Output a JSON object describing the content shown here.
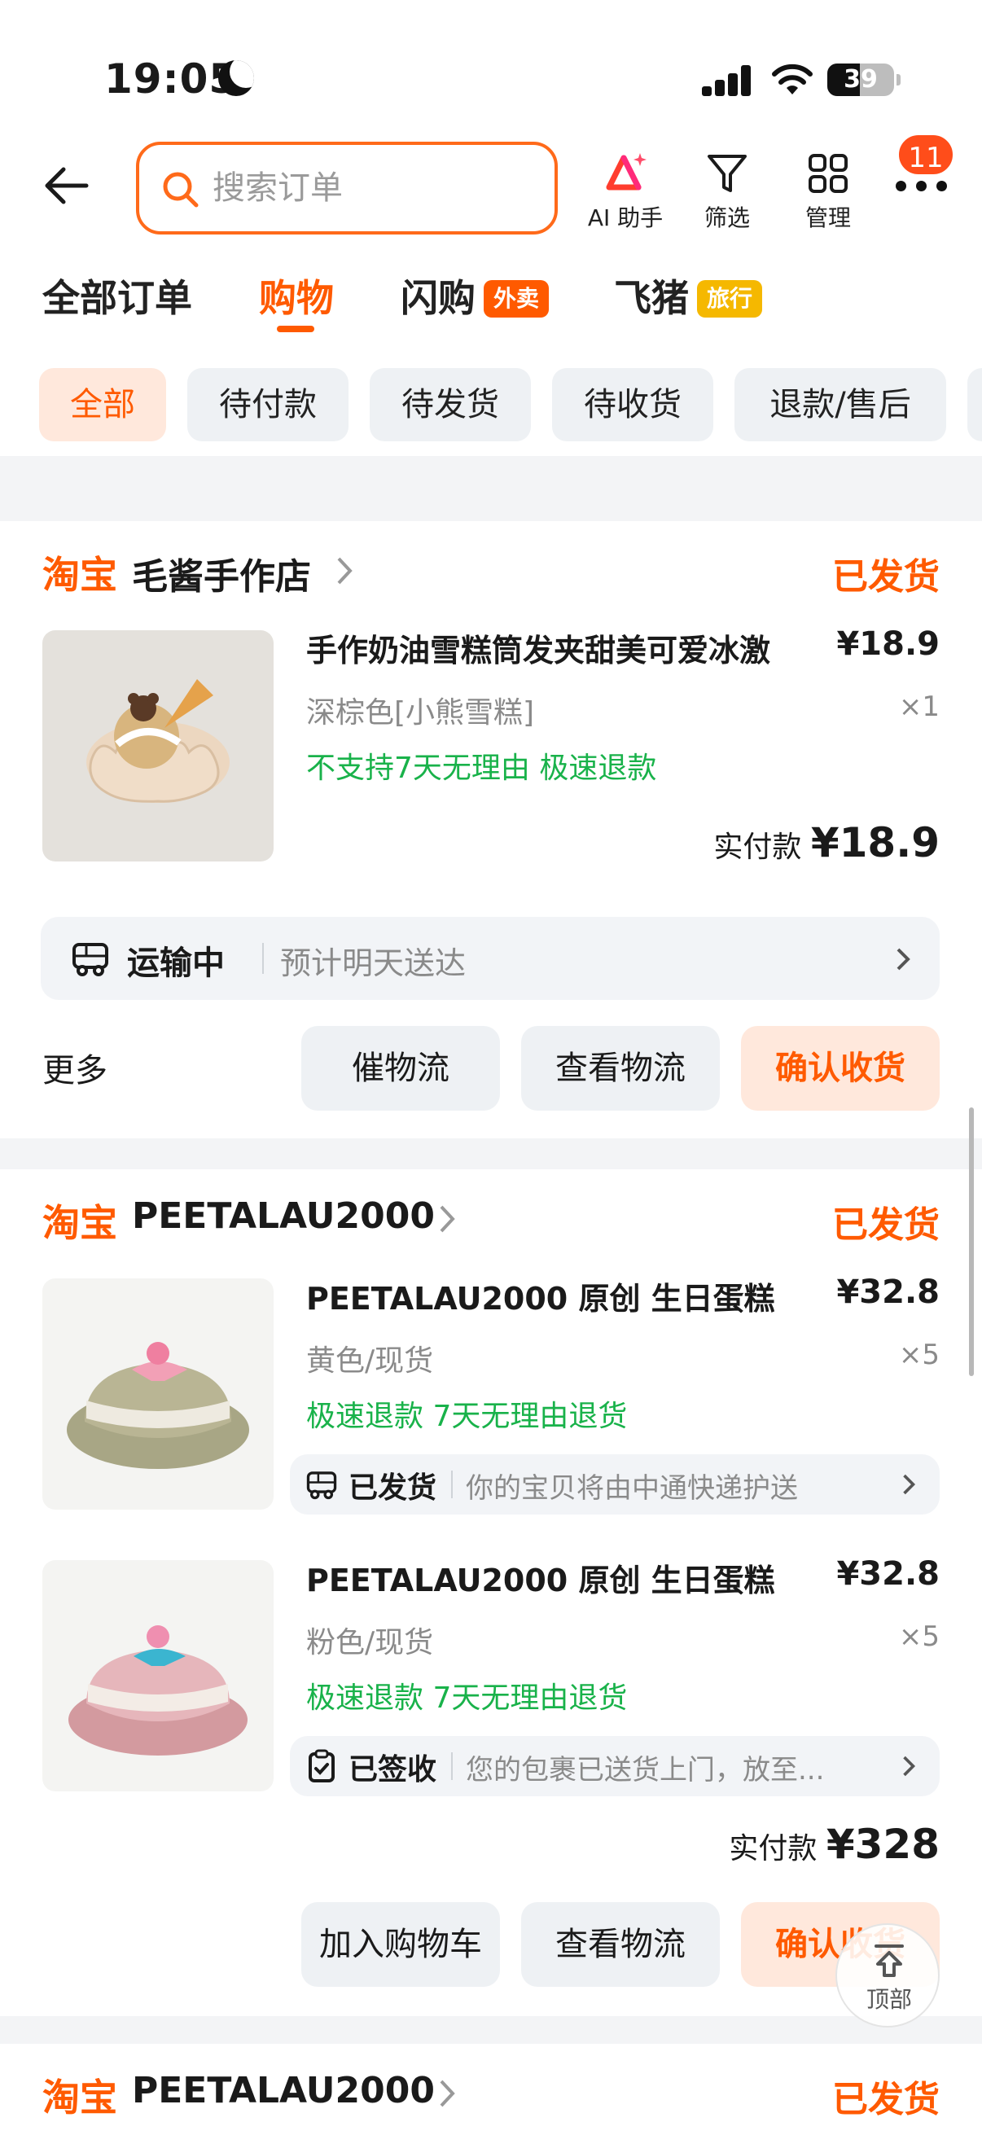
{
  "status_bar": {
    "time": "19:05",
    "battery": "39"
  },
  "search": {
    "placeholder": "搜索订单"
  },
  "toolbar": {
    "ai": "AI 助手",
    "filter": "筛选",
    "manage": "管理",
    "badge": "11"
  },
  "tabs": [
    {
      "label": "全部订单"
    },
    {
      "label": "购物"
    },
    {
      "label": "闪购",
      "tag": "外卖"
    },
    {
      "label": "飞猪",
      "tag": "旅行"
    }
  ],
  "chips": [
    "全部",
    "待付款",
    "待发货",
    "待收货",
    "退款/售后"
  ],
  "colors": {
    "accent": "#ff5a00",
    "green": "#19b24a",
    "tag_yellow": "#f5b800"
  },
  "orders": [
    {
      "brand": "淘宝",
      "shop": "毛酱手作店",
      "status": "已发货",
      "item": {
        "title": "手作奶油雪糕筒发夹甜美可爱冰激",
        "price": "¥18.9",
        "spec": "深棕色[小熊雪糕]",
        "qty": "×1",
        "services": "不支持7天无理由  极速退款"
      },
      "paid_label": "实付款",
      "paid_amount": "¥18.9",
      "tracking": {
        "state": "运输中",
        "detail": "预计明天送达"
      },
      "more": "更多",
      "buttons": [
        "催物流",
        "查看物流",
        "确认收货"
      ]
    },
    {
      "brand": "淘宝",
      "shop": "PEETALAU2000",
      "status": "已发货",
      "items": [
        {
          "title": "PEETALAU2000 原创 生日蛋糕",
          "price": "¥32.8",
          "spec": "黄色/现货",
          "qty": "×5",
          "services": "极速退款  7天无理由退货",
          "track_state": "已发货",
          "track_detail": "你的宝贝将由中通快递护送"
        },
        {
          "title": "PEETALAU2000 原创 生日蛋糕",
          "price": "¥32.8",
          "spec": "粉色/现货",
          "qty": "×5",
          "services": "极速退款  7天无理由退货",
          "track_state": "已签收",
          "track_detail": "您的包裹已送货上门，放至..."
        }
      ],
      "paid_label": "实付款",
      "paid_amount": "¥328",
      "buttons": [
        "加入购物车",
        "查看物流",
        "确认收货"
      ]
    },
    {
      "brand": "淘宝",
      "shop": "PEETALAU2000",
      "status": "已发货"
    }
  ],
  "to_top": "顶部"
}
